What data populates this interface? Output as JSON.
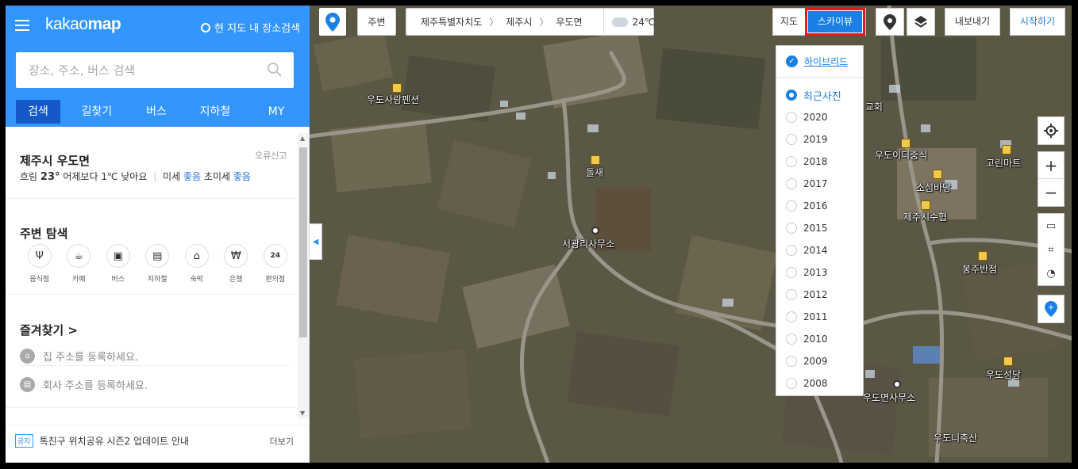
{
  "sidebar": {
    "logo_prefix": "kakao",
    "logo_bold": "map",
    "nearby_search": "현 지도 내 장소검색",
    "search_placeholder": "장소, 주소, 버스 검색",
    "tabs": [
      "검색",
      "길찾기",
      "버스",
      "지하철",
      "MY"
    ],
    "location": {
      "title": "제주시 우도면",
      "report": "오류신고",
      "weather_condition": "흐림",
      "temperature": "23°",
      "compare": "어제보다 1℃ 낮아요",
      "fine_dust_label": "미세",
      "fine_dust_value": "좋음",
      "ultra_dust_label": "초미세",
      "ultra_dust_value": "좋음"
    },
    "nearby": {
      "title": "주변 탐색",
      "categories": [
        {
          "label": "음식점",
          "icon": "fork-knife-icon",
          "glyph": "Ψ"
        },
        {
          "label": "카페",
          "icon": "cup-icon",
          "glyph": "☕"
        },
        {
          "label": "버스",
          "icon": "bus-icon",
          "glyph": "▣"
        },
        {
          "label": "지하철",
          "icon": "subway-icon",
          "glyph": "▤"
        },
        {
          "label": "숙박",
          "icon": "bed-icon",
          "glyph": "⌂"
        },
        {
          "label": "은행",
          "icon": "won-icon",
          "glyph": "₩"
        },
        {
          "label": "편의점",
          "icon": "store-24-icon",
          "glyph": "24"
        }
      ]
    },
    "favorites": {
      "title": "즐겨찾기 >",
      "home": "집 주소를 등록하세요.",
      "work": "회사 주소를 등록하세요."
    },
    "notice": {
      "badge": "공지",
      "text": "톡친구 위치공유 시즌2 업데이트 안내",
      "more": "더보기"
    }
  },
  "map": {
    "nearby_button": "주변",
    "breadcrumb": [
      "제주특별자치도",
      "제주시",
      "우도면"
    ],
    "weather_temp": "24℃",
    "maptype_map": "지도",
    "maptype_sky": "스카이뷰",
    "export": "내보내기",
    "start": "시작하기",
    "dropdown": {
      "hybrid": "하이브리드",
      "recent": "최근사진",
      "years": [
        "2020",
        "2019",
        "2018",
        "2017",
        "2016",
        "2015",
        "2014",
        "2013",
        "2012",
        "2011",
        "2010",
        "2009",
        "2008"
      ]
    },
    "labels": [
      "우도사랑펜션",
      "돌새",
      "서광리사무소",
      "교회",
      "우도이디중식",
      "고린마트",
      "소섬바당",
      "제주시수협",
      "봉주반점",
      "우도성당",
      "우도면사무소",
      "우도니축산"
    ]
  }
}
